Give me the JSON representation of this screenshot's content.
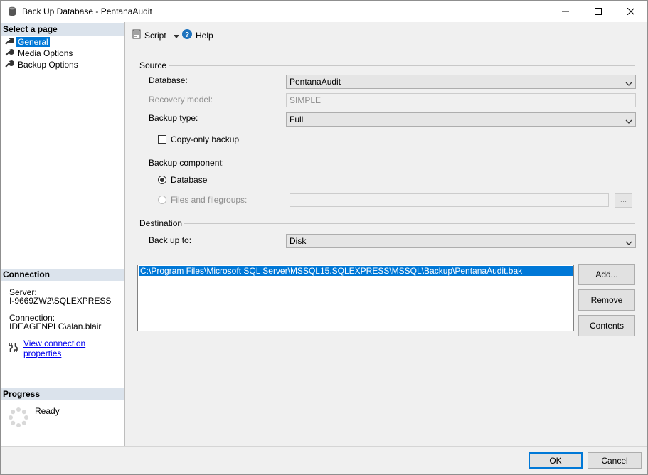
{
  "window": {
    "title": "Back Up Database - PentanaAudit"
  },
  "sidebar": {
    "select_page_header": "Select a page",
    "pages": [
      {
        "label": "General",
        "icon": "wrench-icon",
        "selected": true
      },
      {
        "label": "Media Options",
        "icon": "wrench-icon",
        "selected": false
      },
      {
        "label": "Backup Options",
        "icon": "wrench-icon",
        "selected": false
      }
    ],
    "connection_header": "Connection",
    "server_label": "Server:",
    "server_value": "I-9669ZW2\\SQLEXPRESS",
    "connection_label": "Connection:",
    "connection_value": "IDEAGENPLC\\alan.blair",
    "view_connection_link": "View connection properties",
    "progress_header": "Progress",
    "progress_status": "Ready"
  },
  "toolbar": {
    "script_label": "Script",
    "help_label": "Help"
  },
  "source": {
    "group_label": "Source",
    "database_label": "Database:",
    "database_value": "PentanaAudit",
    "recovery_label": "Recovery model:",
    "recovery_value": "SIMPLE",
    "backup_type_label": "Backup type:",
    "backup_type_value": "Full",
    "copy_only_label": "Copy-only backup",
    "copy_only_checked": false,
    "component_label": "Backup component:",
    "component_database_label": "Database",
    "component_files_label": "Files and filegroups:",
    "ellipsis_label": "..."
  },
  "destination": {
    "group_label": "Destination",
    "backup_to_label": "Back up to:",
    "backup_to_value": "Disk",
    "paths": [
      "C:\\Program Files\\Microsoft SQL Server\\MSSQL15.SQLEXPRESS\\MSSQL\\Backup\\PentanaAudit.bak"
    ],
    "add_label": "Add...",
    "remove_label": "Remove",
    "contents_label": "Contents"
  },
  "footer": {
    "ok_label": "OK",
    "cancel_label": "Cancel"
  },
  "colors": {
    "selection": "#0078d7",
    "section_header": "#dbe3ec"
  }
}
